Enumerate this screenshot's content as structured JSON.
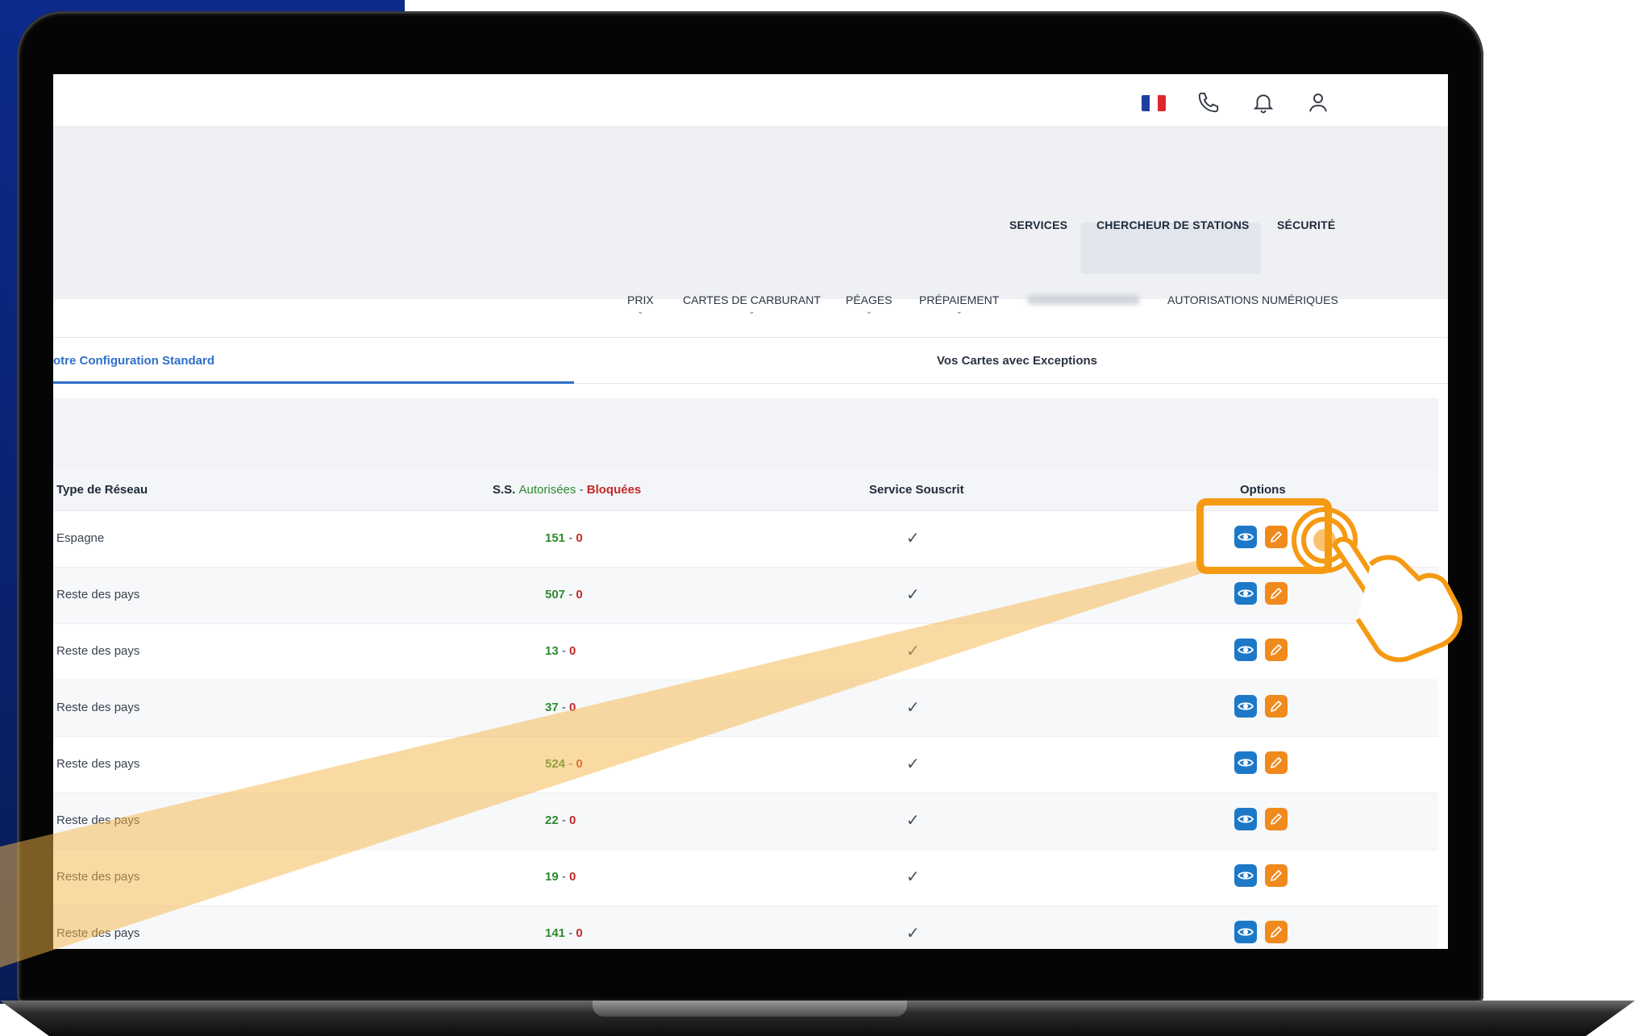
{
  "header": {
    "icons": [
      "france-flag-icon",
      "phone-icon",
      "bell-icon",
      "user-icon"
    ],
    "flag_colors": [
      "#1f3f9e",
      "#ffffff",
      "#e1262c"
    ]
  },
  "nav": {
    "primary": [
      "SERVICES",
      "CHERCHEUR DE STATIONS",
      "SÉCURITÉ"
    ],
    "secondary": [
      "PRIX",
      "CARTES DE CARBURANT",
      "PÉAGES",
      "PRÉPAIEMENT",
      "AUTORISATIONS NUMÉRIQUES"
    ]
  },
  "tabs": {
    "active": "otre Configuration Standard",
    "other": "Vos Cartes avec Exceptions"
  },
  "table": {
    "headers": {
      "type": "Type de Réseau",
      "ss_prefix": "S.S.",
      "ss_authorized": "Autorisées",
      "ss_dash": "-",
      "ss_blocked": "Bloquées",
      "service": "Service Souscrit",
      "options": "Options"
    },
    "rows": [
      {
        "type": "Espagne",
        "authorized": "151",
        "blocked": "0"
      },
      {
        "type": "Reste des pays",
        "authorized": "507",
        "blocked": "0"
      },
      {
        "type": "Reste des pays",
        "authorized": "13",
        "blocked": "0"
      },
      {
        "type": "Reste des pays",
        "authorized": "37",
        "blocked": "0"
      },
      {
        "type": "Reste des pays",
        "authorized": "524",
        "blocked": "0"
      },
      {
        "type": "Reste des pays",
        "authorized": "22",
        "blocked": "0"
      },
      {
        "type": "Reste des pays",
        "authorized": "19",
        "blocked": "0"
      },
      {
        "type": "Reste des pays",
        "authorized": "141",
        "blocked": "0"
      }
    ]
  },
  "colors": {
    "accent": "#2f6fc8",
    "authorized": "#2e8b2e",
    "blocked": "#c62828",
    "view_button": "#1e78c8",
    "edit_button": "#f08a1c",
    "highlight": "#f59a12"
  }
}
